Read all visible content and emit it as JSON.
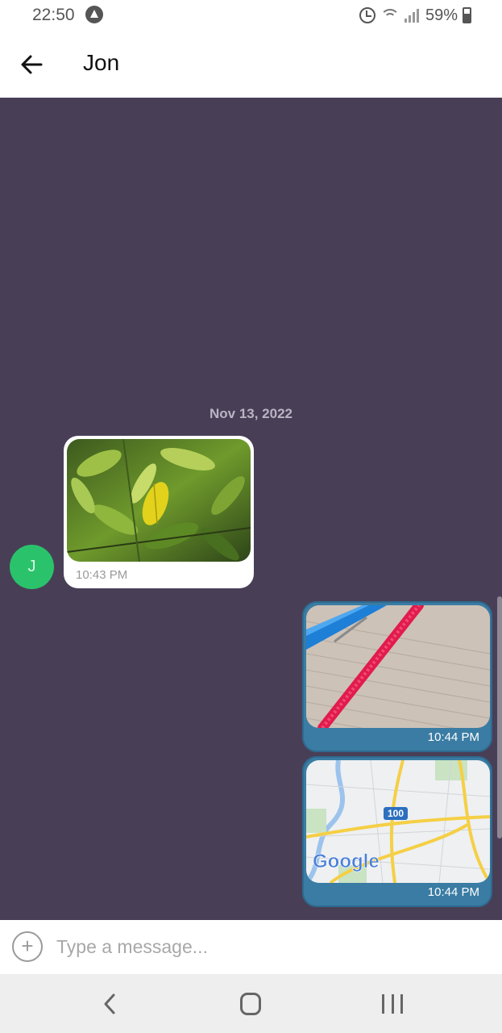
{
  "status_bar": {
    "time": "22:50",
    "battery": "59%",
    "icons": [
      "app-notification-icon",
      "alarm-icon",
      "wifi-icon",
      "signal-icon",
      "battery-icon"
    ]
  },
  "app_bar": {
    "title": "Jon",
    "back_icon": "arrow-left-icon"
  },
  "chat": {
    "background_color": "#483f57",
    "date_separator": "Nov 13, 2022",
    "contact_avatar_initial": "J",
    "avatar_color": "#2ac36b",
    "outgoing_color": "#3a7ca3",
    "messages": [
      {
        "direction": "incoming",
        "type": "image",
        "image": "green-leaves-photo",
        "time": "10:43 PM"
      },
      {
        "direction": "outgoing",
        "type": "image",
        "image": "red-cable-on-wood-photo",
        "time": "10:44 PM"
      },
      {
        "direction": "outgoing",
        "type": "image",
        "image": "map-snapshot",
        "map_logo": "Google",
        "road_label": "100",
        "time": "10:44 PM"
      }
    ]
  },
  "input": {
    "placeholder": "Type a message...",
    "value": "",
    "attach_icon": "plus-circle-icon"
  },
  "nav_bar": {
    "icons": [
      "nav-back-icon",
      "nav-home-icon",
      "nav-recent-apps-icon"
    ]
  }
}
